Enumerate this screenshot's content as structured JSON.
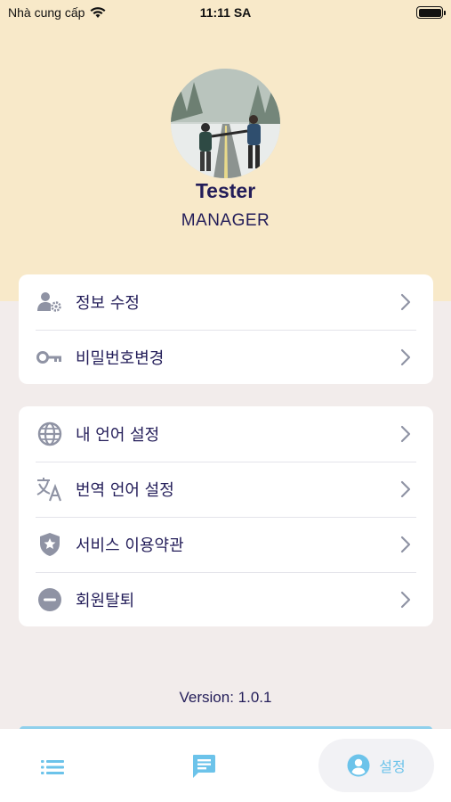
{
  "status_bar": {
    "carrier": "Nhà cung cấp",
    "time": "11:11 SA"
  },
  "profile": {
    "name": "Tester",
    "role": "MANAGER"
  },
  "account_menu": [
    {
      "label": "정보 수정",
      "icon": "user-gear-icon"
    },
    {
      "label": "비밀번호변경",
      "icon": "key-icon"
    }
  ],
  "settings_menu": [
    {
      "label": "내 언어 설정",
      "icon": "globe-icon"
    },
    {
      "label": "번역 언어 설정",
      "icon": "translate-icon"
    },
    {
      "label": "서비스 이용약관",
      "icon": "shield-star-icon"
    },
    {
      "label": "회원탈퇴",
      "icon": "minus-circle-icon"
    }
  ],
  "version": "Version: 1.0.1",
  "bottom_nav": {
    "items": [
      {
        "name": "list",
        "icon": "list-icon"
      },
      {
        "name": "chat",
        "icon": "chat-icon"
      },
      {
        "name": "settings",
        "icon": "person-icon",
        "label": "설정",
        "active": true
      }
    ]
  },
  "colors": {
    "header_bg": "#f8e9c9",
    "page_bg": "#f2eceb",
    "text_primary": "#231d59",
    "accent": "#6cc3ea",
    "icon_gray": "#8f93a4"
  }
}
